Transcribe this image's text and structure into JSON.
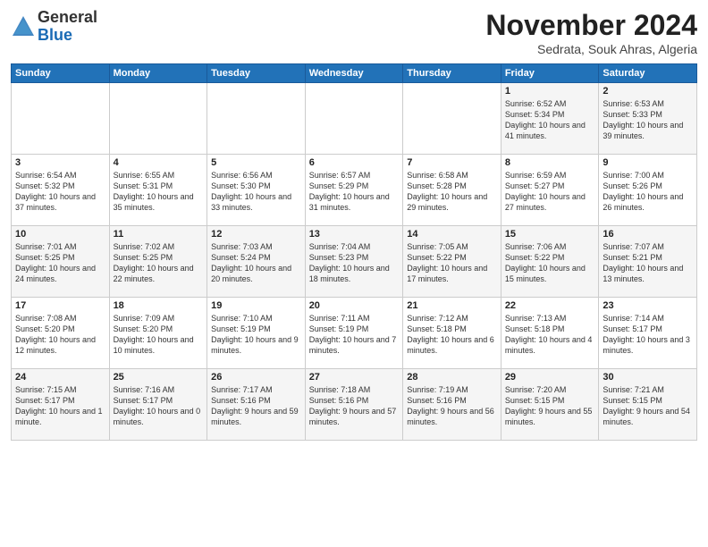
{
  "logo": {
    "general": "General",
    "blue": "Blue"
  },
  "title": "November 2024",
  "location": "Sedrata, Souk Ahras, Algeria",
  "headers": [
    "Sunday",
    "Monday",
    "Tuesday",
    "Wednesday",
    "Thursday",
    "Friday",
    "Saturday"
  ],
  "weeks": [
    [
      {
        "day": "",
        "info": ""
      },
      {
        "day": "",
        "info": ""
      },
      {
        "day": "",
        "info": ""
      },
      {
        "day": "",
        "info": ""
      },
      {
        "day": "",
        "info": ""
      },
      {
        "day": "1",
        "info": "Sunrise: 6:52 AM\nSunset: 5:34 PM\nDaylight: 10 hours and 41 minutes."
      },
      {
        "day": "2",
        "info": "Sunrise: 6:53 AM\nSunset: 5:33 PM\nDaylight: 10 hours and 39 minutes."
      }
    ],
    [
      {
        "day": "3",
        "info": "Sunrise: 6:54 AM\nSunset: 5:32 PM\nDaylight: 10 hours and 37 minutes."
      },
      {
        "day": "4",
        "info": "Sunrise: 6:55 AM\nSunset: 5:31 PM\nDaylight: 10 hours and 35 minutes."
      },
      {
        "day": "5",
        "info": "Sunrise: 6:56 AM\nSunset: 5:30 PM\nDaylight: 10 hours and 33 minutes."
      },
      {
        "day": "6",
        "info": "Sunrise: 6:57 AM\nSunset: 5:29 PM\nDaylight: 10 hours and 31 minutes."
      },
      {
        "day": "7",
        "info": "Sunrise: 6:58 AM\nSunset: 5:28 PM\nDaylight: 10 hours and 29 minutes."
      },
      {
        "day": "8",
        "info": "Sunrise: 6:59 AM\nSunset: 5:27 PM\nDaylight: 10 hours and 27 minutes."
      },
      {
        "day": "9",
        "info": "Sunrise: 7:00 AM\nSunset: 5:26 PM\nDaylight: 10 hours and 26 minutes."
      }
    ],
    [
      {
        "day": "10",
        "info": "Sunrise: 7:01 AM\nSunset: 5:25 PM\nDaylight: 10 hours and 24 minutes."
      },
      {
        "day": "11",
        "info": "Sunrise: 7:02 AM\nSunset: 5:25 PM\nDaylight: 10 hours and 22 minutes."
      },
      {
        "day": "12",
        "info": "Sunrise: 7:03 AM\nSunset: 5:24 PM\nDaylight: 10 hours and 20 minutes."
      },
      {
        "day": "13",
        "info": "Sunrise: 7:04 AM\nSunset: 5:23 PM\nDaylight: 10 hours and 18 minutes."
      },
      {
        "day": "14",
        "info": "Sunrise: 7:05 AM\nSunset: 5:22 PM\nDaylight: 10 hours and 17 minutes."
      },
      {
        "day": "15",
        "info": "Sunrise: 7:06 AM\nSunset: 5:22 PM\nDaylight: 10 hours and 15 minutes."
      },
      {
        "day": "16",
        "info": "Sunrise: 7:07 AM\nSunset: 5:21 PM\nDaylight: 10 hours and 13 minutes."
      }
    ],
    [
      {
        "day": "17",
        "info": "Sunrise: 7:08 AM\nSunset: 5:20 PM\nDaylight: 10 hours and 12 minutes."
      },
      {
        "day": "18",
        "info": "Sunrise: 7:09 AM\nSunset: 5:20 PM\nDaylight: 10 hours and 10 minutes."
      },
      {
        "day": "19",
        "info": "Sunrise: 7:10 AM\nSunset: 5:19 PM\nDaylight: 10 hours and 9 minutes."
      },
      {
        "day": "20",
        "info": "Sunrise: 7:11 AM\nSunset: 5:19 PM\nDaylight: 10 hours and 7 minutes."
      },
      {
        "day": "21",
        "info": "Sunrise: 7:12 AM\nSunset: 5:18 PM\nDaylight: 10 hours and 6 minutes."
      },
      {
        "day": "22",
        "info": "Sunrise: 7:13 AM\nSunset: 5:18 PM\nDaylight: 10 hours and 4 minutes."
      },
      {
        "day": "23",
        "info": "Sunrise: 7:14 AM\nSunset: 5:17 PM\nDaylight: 10 hours and 3 minutes."
      }
    ],
    [
      {
        "day": "24",
        "info": "Sunrise: 7:15 AM\nSunset: 5:17 PM\nDaylight: 10 hours and 1 minute."
      },
      {
        "day": "25",
        "info": "Sunrise: 7:16 AM\nSunset: 5:17 PM\nDaylight: 10 hours and 0 minutes."
      },
      {
        "day": "26",
        "info": "Sunrise: 7:17 AM\nSunset: 5:16 PM\nDaylight: 9 hours and 59 minutes."
      },
      {
        "day": "27",
        "info": "Sunrise: 7:18 AM\nSunset: 5:16 PM\nDaylight: 9 hours and 57 minutes."
      },
      {
        "day": "28",
        "info": "Sunrise: 7:19 AM\nSunset: 5:16 PM\nDaylight: 9 hours and 56 minutes."
      },
      {
        "day": "29",
        "info": "Sunrise: 7:20 AM\nSunset: 5:15 PM\nDaylight: 9 hours and 55 minutes."
      },
      {
        "day": "30",
        "info": "Sunrise: 7:21 AM\nSunset: 5:15 PM\nDaylight: 9 hours and 54 minutes."
      }
    ]
  ]
}
